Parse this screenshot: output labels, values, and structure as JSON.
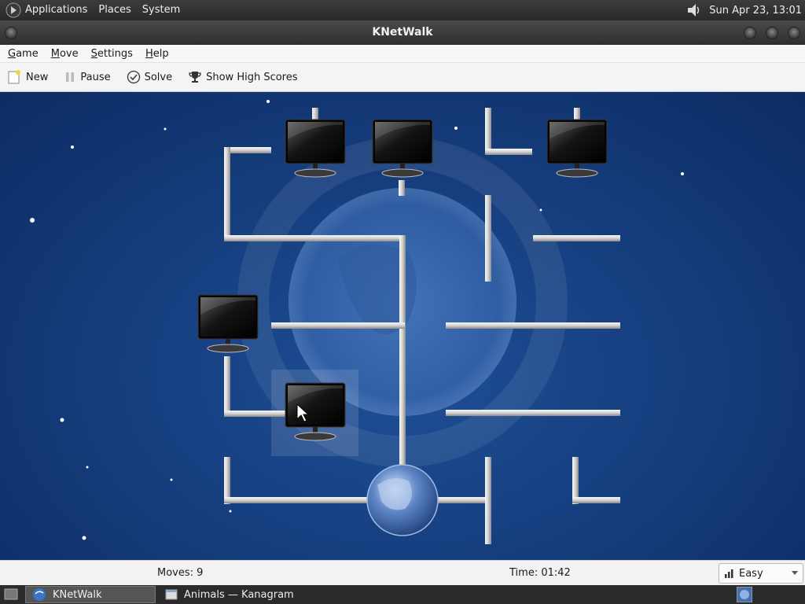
{
  "top_panel": {
    "menus": [
      "Applications",
      "Places",
      "System"
    ],
    "clock": "Sun Apr 23, 13:01",
    "icons": {
      "apps": "gnome-foot-icon",
      "volume": "speaker-icon"
    }
  },
  "window": {
    "title": "KNetWalk"
  },
  "menubar": {
    "items": [
      {
        "label": "Game",
        "accel": "G"
      },
      {
        "label": "Move",
        "accel": "M"
      },
      {
        "label": "Settings",
        "accel": "S"
      },
      {
        "label": "Help",
        "accel": "H"
      }
    ]
  },
  "toolbar": {
    "new_label": "New",
    "pause_label": "Pause",
    "solve_label": "Solve",
    "scores_label": "Show High Scores"
  },
  "status": {
    "moves": "Moves: 9",
    "time": "Time: 01:42",
    "difficulty": "Easy"
  },
  "taskbar": {
    "tasks": [
      {
        "label": "KNetWalk",
        "active": true
      },
      {
        "label": "Animals — Kanagram",
        "active": false
      }
    ]
  },
  "colors": {
    "board_bg": "#163f80",
    "pipe": "#e6e6e6",
    "monitor_screen": "#0a0a0a"
  }
}
